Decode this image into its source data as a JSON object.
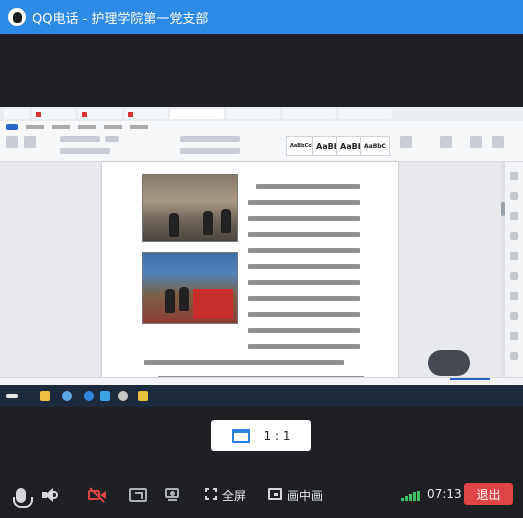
{
  "window": {
    "title": "QQ电话 - 护理学院第一党支部",
    "app_icon": "qq-penguin-icon"
  },
  "shared_screen": {
    "description_visible": false,
    "ribbon_styles": [
      "AaBbCcD",
      "AaBb",
      "AaBbl",
      "AaBbC"
    ]
  },
  "view_controls": {
    "ratio_label": "1 : 1",
    "ratio_icon": "window-icon"
  },
  "controls": {
    "mic_icon": "microphone-icon",
    "speaker_icon": "speaker-icon",
    "camera_icon": "camera-off-icon",
    "share_icon": "screen-share-icon",
    "present_icon": "presenter-icon",
    "fullscreen_label": "全屏",
    "pip_label": "画中画",
    "signal_icon": "signal-strength-icon",
    "call_time": "07:13",
    "exit_label": "退出"
  },
  "colors": {
    "titlebar": "#2d8ae6",
    "exit": "#e04545",
    "signal": "#3ec16a",
    "background": "#1e2023"
  }
}
